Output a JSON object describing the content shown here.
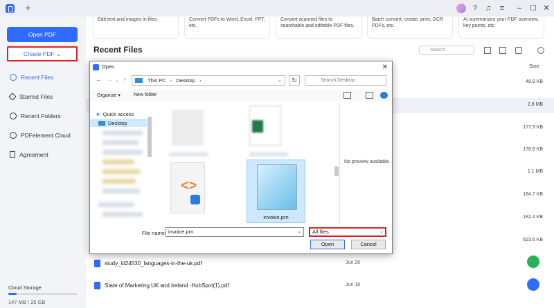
{
  "window": {
    "new_tab": "+"
  },
  "sidebar": {
    "open_pdf": "Open PDF",
    "create_pdf": "Create PDF",
    "create_chevron": "⌄",
    "items": [
      {
        "label": "Recent Files",
        "icon": "clock-icon",
        "active": true
      },
      {
        "label": "Starred Files",
        "icon": "star-icon"
      },
      {
        "label": "Recent Folders",
        "icon": "clock-icon"
      },
      {
        "label": "PDFelement Cloud",
        "icon": "cloud-icon"
      },
      {
        "label": "Agreement",
        "icon": "document-icon"
      }
    ],
    "storage_label": "Cloud Storage",
    "storage_value": "147 MB / 25 GB",
    "storage_fraction": 0.006
  },
  "cards": [
    "Edit text and images in files.",
    "Convert PDFs to Word, Excel, PPT, etc.",
    "Convert scanned files to searchable and editable PDF files.",
    "Batch convert, create, print, OCR PDFs, etc.",
    "AI summarizes your PDF overview, key points, etc."
  ],
  "main": {
    "title": "Recent Files",
    "search_placeholder": "Search",
    "size_header": "Size",
    "sizes": [
      "48.9 KB",
      "2.8 MB",
      "177.9 KB",
      "178.6 KB",
      "1.1 MB",
      "184.7 KB",
      "182.4 KB",
      "823.6 KB"
    ],
    "files": [
      {
        "name": "study_id24530_languages-in-the-uk.pdf",
        "date": "Jun 26"
      },
      {
        "name": "State of Marketing UK and Ireland -HubSpot(1).pdf",
        "date": "Jun 18"
      }
    ]
  },
  "dialog": {
    "title": "Open",
    "path": [
      "This PC",
      "Desktop"
    ],
    "search_placeholder": "Search Desktop",
    "organize": "Organize ▾",
    "new_folder": "New folder",
    "tree": [
      {
        "label": "Quick access",
        "icon": "star-icon"
      },
      {
        "label": "Desktop",
        "icon": "desktop-icon",
        "selected": true
      }
    ],
    "selected_file": "invoice.prn",
    "no_preview": "No preview available.",
    "file_name_label": "File name:",
    "file_name_value": "invoice.prn",
    "file_type": "All files",
    "open_button": "Open",
    "cancel_button": "Cancel",
    "close": "✕"
  }
}
